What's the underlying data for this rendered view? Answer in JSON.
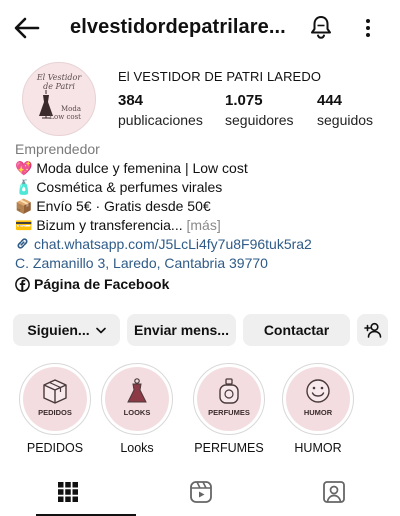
{
  "header": {
    "username": "elvestidordepatrilare..."
  },
  "profile": {
    "avatar": {
      "title_line1": "El Vestidor",
      "title_line2": "de Patri",
      "sub_line1": "Moda",
      "sub_line2": "Low cost"
    },
    "full_name": "El VESTIDOR DE PATRI LAREDO",
    "stats": [
      {
        "value": "384",
        "label": "publicaciones"
      },
      {
        "value": "1.075",
        "label": "seguidores"
      },
      {
        "value": "444",
        "label": "seguidos"
      }
    ]
  },
  "bio": {
    "category": "Emprendedor",
    "lines": [
      "💖 Moda dulce y femenina | Low cost",
      "🧴 Cosmética & perfumes virales",
      "📦 Envío 5€ · Gratis desde 50€",
      "💳 Bizum y transferencia... "
    ],
    "more": "[más]",
    "link": "chat.whatsapp.com/J5LcLi4fy7u8F96tuk5ra2",
    "address": "C. Zamanillo 3, Laredo, Cantabria 39770"
  },
  "facebook_label": "Página de Facebook",
  "buttons": {
    "following": "Siguien...",
    "message": "Enviar mens...",
    "contact": "Contactar"
  },
  "highlights": [
    {
      "inner": "PEDIDOS",
      "caption": "PEDIDOS",
      "icon": "box-icon"
    },
    {
      "inner": "LOOKS",
      "caption": "Looks",
      "icon": "dress-icon"
    },
    {
      "inner": "PERFUMES",
      "caption": "PERFUMES",
      "icon": "perfume-icon"
    },
    {
      "inner": "HUMOR",
      "caption": "HUMOR",
      "icon": "smiley-icon"
    }
  ],
  "colors": {
    "link": "#2f5b88",
    "button_bg": "#efefef",
    "highlight_bg": "#f3dde0"
  }
}
